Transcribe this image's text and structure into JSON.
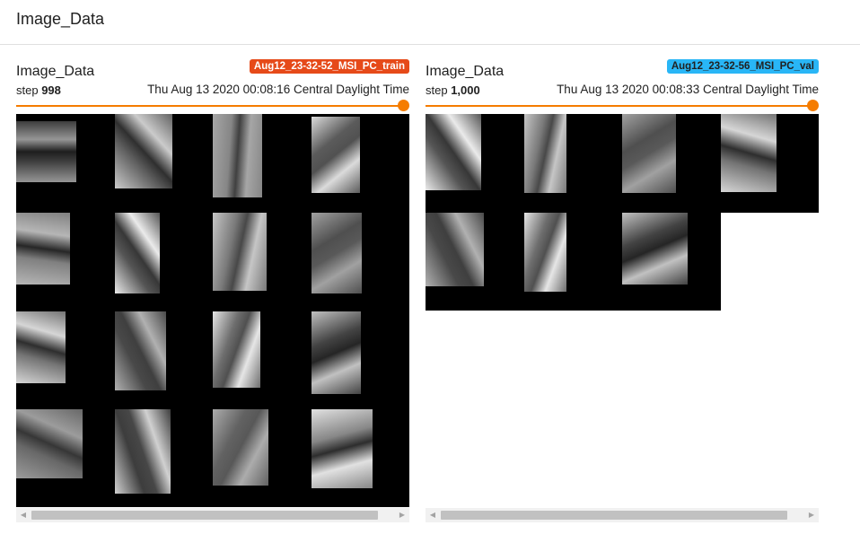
{
  "header": {
    "title": "Image_Data"
  },
  "cards": [
    {
      "title": "Image_Data",
      "run_name": "Aug12_23-32-52_MSI_PC_train",
      "run_color": "#e64a19",
      "run_text_color": "#ffffff",
      "step_label": "step",
      "step_value": "998",
      "timestamp": "Thu Aug 13 2020 00:08:16 Central Daylight Time",
      "slider_value": 1.0
    },
    {
      "title": "Image_Data",
      "run_name": "Aug12_23-32-56_MSI_PC_val",
      "run_color": "#29b6f6",
      "run_text_color": "#212121",
      "step_label": "step",
      "step_value": "1,000",
      "timestamp": "Thu Aug 13 2020 00:08:33 Central Daylight Time",
      "slider_value": 1.0
    }
  ],
  "colors": {
    "accent": "#f57c00"
  },
  "icons": {
    "scroll_left": "arrow-left-icon",
    "scroll_right": "arrow-right-icon"
  }
}
